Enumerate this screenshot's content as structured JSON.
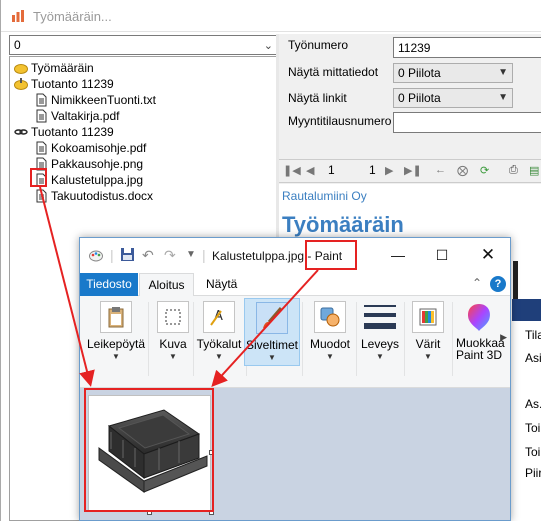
{
  "background_window": {
    "title": "Työmääräin...",
    "tree": {
      "filter_value": "0",
      "items": [
        {
          "label": "Työmääräin",
          "icon": "folder-yellow-icon"
        },
        {
          "label": "Tuotanto 11239",
          "icon": "folder-open-icon"
        },
        {
          "label": "NimikkeenTuonti.txt",
          "icon": "document-icon"
        },
        {
          "label": "Valtakirja.pdf",
          "icon": "document-icon"
        },
        {
          "label": "Tuotanto 11239",
          "icon": "link-icon"
        },
        {
          "label": "Kokoamisohje.pdf",
          "icon": "document-icon"
        },
        {
          "label": "Pakkausohje.png",
          "icon": "document-icon"
        },
        {
          "label": "Kalustetulppa.jpg",
          "icon": "document-icon"
        },
        {
          "label": "Takuutodistus.docx",
          "icon": "document-icon"
        }
      ]
    },
    "form": {
      "job_number_label": "Työnumero",
      "job_number_value": "11239",
      "show_measurements_label": "Näytä mittatiedot",
      "show_measurements_value": "0 Piilota",
      "show_links_label": "Näytä linkit",
      "show_links_value": "0 Piilota",
      "sales_order_label": "Myyntitilausnumero",
      "sales_order_value": ""
    },
    "report_toolbar": {
      "page_current": "1",
      "page_total": "1"
    },
    "report": {
      "company": "Rautalumiini Oy",
      "title": "Työmääräin",
      "side_fragments": [
        "Tila",
        "Asi",
        "As.",
        "Toi",
        "Toi",
        "Piir"
      ]
    }
  },
  "paint_window": {
    "title": "Kalustetulppa.jpg - Paint",
    "tabs": {
      "file": "Tiedosto",
      "home": "Aloitus",
      "view": "Näytä"
    },
    "ribbon": {
      "clipboard": "Leikepöytä",
      "image": "Kuva",
      "tools": "Työkalut",
      "brushes": "Siveltimet",
      "shapes": "Muodot",
      "size": "Leveys",
      "colors": "Värit",
      "edit_paint3d_line1": "Muokkaa",
      "edit_paint3d_line2": "Paint 3D"
    },
    "help": "?"
  },
  "colors": {
    "paint_accent": "#1979ca",
    "report_blue": "#3b7fc1",
    "annotation_red": "#e52222"
  }
}
